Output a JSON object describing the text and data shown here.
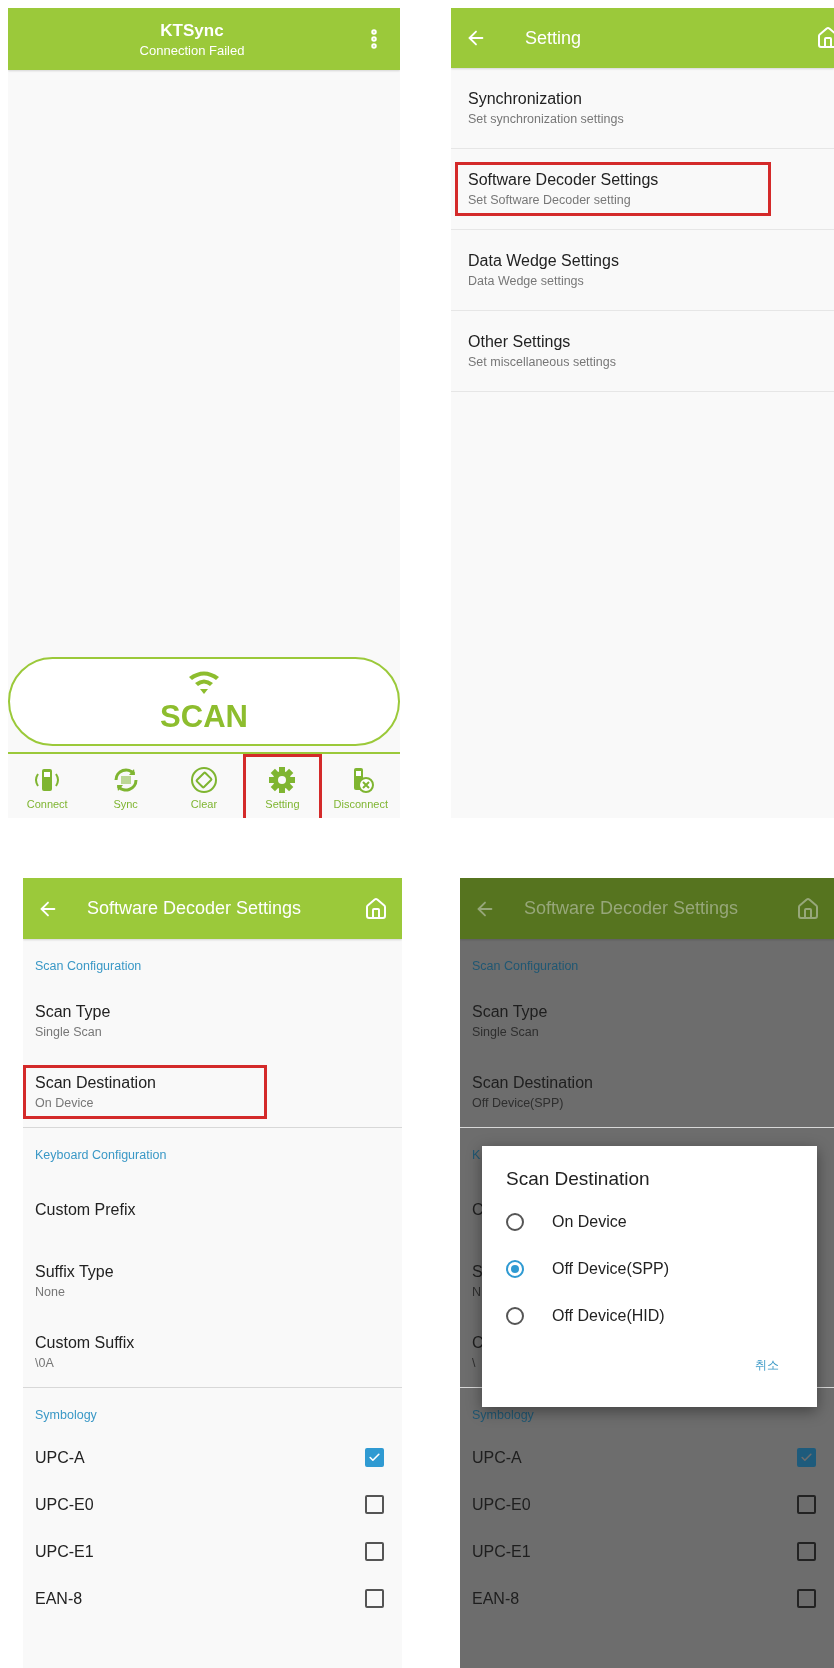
{
  "screens": [
    {
      "kind": "main",
      "title": "KTSync",
      "subtitle": "Connection Failed",
      "scan_label": "SCAN",
      "nav": [
        {
          "kind": "connect",
          "label": "Connect",
          "highlighted": false
        },
        {
          "kind": "sync",
          "label": "Sync",
          "highlighted": false
        },
        {
          "kind": "clear",
          "label": "Clear",
          "highlighted": false
        },
        {
          "kind": "setting",
          "label": "Setting",
          "highlighted": true
        },
        {
          "kind": "disconnect",
          "label": "Disconnect",
          "highlighted": false
        }
      ]
    },
    {
      "kind": "list",
      "title": "Setting",
      "items": [
        {
          "title": "Synchronization",
          "summary": "Set synchronization settings",
          "highlighted": false
        },
        {
          "title": "Software Decoder Settings",
          "summary": "Set Software Decoder setting",
          "highlighted": true
        },
        {
          "title": "Data Wedge Settings",
          "summary": "Data Wedge settings",
          "highlighted": false
        },
        {
          "title": "Other Settings",
          "summary": "Set miscellaneous settings",
          "highlighted": false
        }
      ]
    },
    {
      "kind": "prefs",
      "title": "Software Decoder Settings",
      "dimmed": false,
      "sections": [
        {
          "header": "Scan Configuration",
          "rows": [
            {
              "kind": "text",
              "title": "Scan Type",
              "summary": "Single Scan",
              "highlighted": false
            },
            {
              "kind": "text",
              "title": "Scan Destination",
              "summary": "On Device",
              "highlighted": true
            }
          ]
        },
        {
          "header": "Keyboard Configuration",
          "rows": [
            {
              "kind": "text",
              "title": "Custom Prefix",
              "highlighted": false
            },
            {
              "kind": "text",
              "title": "Suffix Type",
              "summary": "None",
              "highlighted": false
            },
            {
              "kind": "text",
              "title": "Custom Suffix",
              "summary": "\\0A",
              "highlighted": false
            }
          ]
        },
        {
          "header": "Symbology",
          "rows": [
            {
              "kind": "check",
              "title": "UPC-A",
              "checked": true
            },
            {
              "kind": "check",
              "title": "UPC-E0",
              "checked": false
            },
            {
              "kind": "check",
              "title": "UPC-E1",
              "checked": false
            },
            {
              "kind": "check",
              "title": "EAN-8",
              "checked": false
            }
          ]
        }
      ]
    },
    {
      "kind": "prefs",
      "title": "Software Decoder Settings",
      "dimmed": true,
      "sections": [
        {
          "header": "Scan Configuration",
          "rows": [
            {
              "kind": "text",
              "title": "Scan Type",
              "summary": "Single Scan",
              "highlighted": false
            },
            {
              "kind": "text",
              "title": "Scan Destination",
              "summary": "Off Device(SPP)",
              "highlighted": false
            }
          ]
        },
        {
          "header": "K",
          "rows": [
            {
              "kind": "text",
              "title": "C",
              "highlighted": false
            },
            {
              "kind": "text",
              "title": "S",
              "summary": "N",
              "highlighted": false
            },
            {
              "kind": "text",
              "title": "C",
              "summary": "\\",
              "highlighted": false
            }
          ]
        },
        {
          "header": "Symbology",
          "rows": [
            {
              "kind": "check",
              "title": "UPC-A",
              "checked": true
            },
            {
              "kind": "check",
              "title": "UPC-E0",
              "checked": false
            },
            {
              "kind": "check",
              "title": "UPC-E1",
              "checked": false
            },
            {
              "kind": "check",
              "title": "EAN-8",
              "checked": false
            }
          ]
        }
      ],
      "dialog": {
        "title": "Scan Destination",
        "options": [
          {
            "label": "On Device",
            "selected": false
          },
          {
            "label": "Off Device(SPP)",
            "selected": true
          },
          {
            "label": "Off Device(HID)",
            "selected": false
          }
        ],
        "cancel": "취소"
      }
    }
  ]
}
